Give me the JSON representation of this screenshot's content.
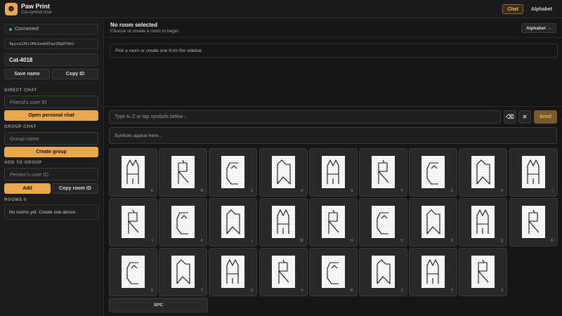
{
  "app": {
    "title": "Paw Print",
    "subtitle": "Cat-symbol chat",
    "logo_icon": "paw-icon"
  },
  "nav": {
    "chat": "Chat",
    "alphabet": "Alphabet"
  },
  "sidebar": {
    "status": "Connected",
    "user_id": "9gysa1X5r2Mu1wmGXXqz38pDY9n2",
    "name_value": "Cat-4018",
    "save_name": "Save name",
    "copy_id": "Copy ID",
    "direct_chat_label": "DIRECT CHAT",
    "friend_placeholder": "Friend's user ID",
    "open_chat": "Open personal chat",
    "group_chat_label": "GROUP CHAT",
    "group_placeholder": "Group name",
    "create_group": "Create group",
    "add_to_group_label": "ADD TO GROUP",
    "person_placeholder": "Person's user ID",
    "add": "Add",
    "copy_room_id": "Copy room ID",
    "rooms_label": "ROOMS 0",
    "no_rooms": "No rooms yet. Create one above."
  },
  "main": {
    "room_title": "No room selected",
    "room_subtitle": "Choose or create a room to begin.",
    "alphabet_button": "Alphabet →",
    "empty_message": "Pick a room or create one from the sidebar.",
    "input_placeholder": "Type A–Z or tap symbols below ↓",
    "backspace_icon": "backspace-icon",
    "clear_icon": "close-icon",
    "send": "Send",
    "symbols_placeholder": "Symbols appear here...",
    "space_key": "SPC"
  },
  "letters": [
    "A",
    "B",
    "C",
    "D",
    "E",
    "F",
    "G",
    "H",
    "I",
    "J",
    "K",
    "L",
    "M",
    "N",
    "O",
    "P",
    "Q",
    "R",
    "S",
    "T",
    "U",
    "V",
    "W",
    "X",
    "Y",
    "Z"
  ],
  "colors": {
    "accent": "#e9a84a",
    "background": "#161618",
    "status_dot": "#3ec06a"
  }
}
